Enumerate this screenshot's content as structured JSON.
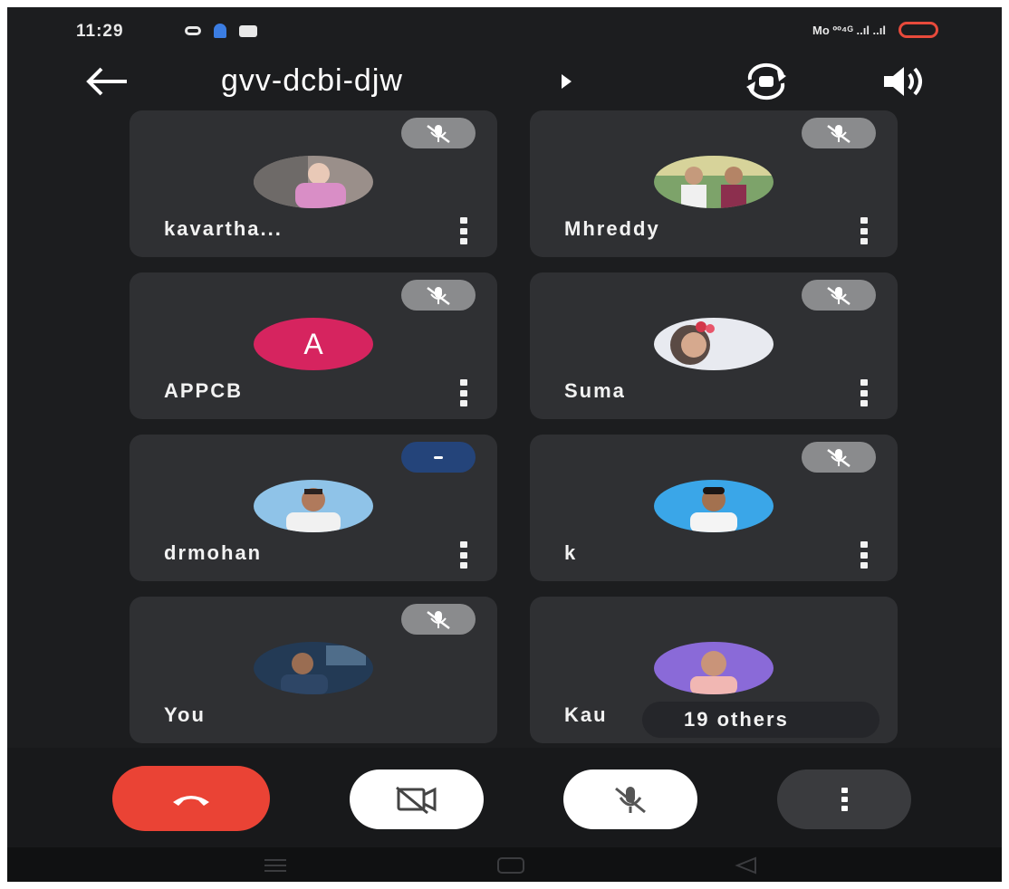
{
  "status_bar": {
    "time": "11:29",
    "signal_text": "Mo ºº⁴ᴳ ..ıl ..ıl"
  },
  "header": {
    "meeting_code": "gvv-dcbi-djw",
    "icons": [
      "back-arrow-icon",
      "caret-right-icon",
      "switch-camera-icon",
      "speaker-icon"
    ]
  },
  "participants": [
    {
      "name": "kavartha...",
      "mic": "muted",
      "avatar": "photo"
    },
    {
      "name": "Mhreddy",
      "mic": "muted",
      "avatar": "photo"
    },
    {
      "name": "APPCB",
      "mic": "muted",
      "avatar": "letter",
      "avatar_letter": "A",
      "avatar_color": "#d6245f"
    },
    {
      "name": "Suma",
      "mic": "muted",
      "avatar": "photo"
    },
    {
      "name": "drmohan",
      "mic": "speaking",
      "avatar": "photo"
    },
    {
      "name": "k",
      "mic": "muted",
      "avatar": "photo"
    },
    {
      "name": "You",
      "mic": "muted",
      "avatar": "photo"
    },
    {
      "name": "Kau",
      "mic": "none",
      "avatar": "photo",
      "others_label": "19 others"
    }
  ],
  "controls": {
    "buttons": [
      "end-call",
      "camera-off",
      "mic-off",
      "more-options"
    ],
    "end_call_color": "#ea4335"
  },
  "colors": {
    "background": "#1c1d1f",
    "tile": "#2f3033",
    "mute_pill": "#8a8b8d",
    "speaking_pill": "#24447a"
  }
}
